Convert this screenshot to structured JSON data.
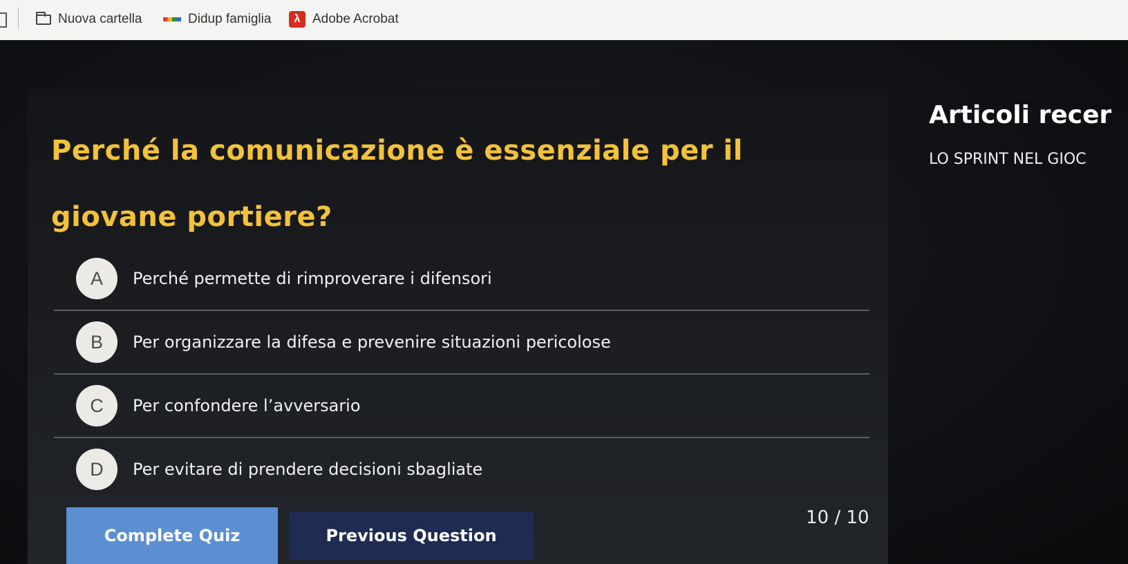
{
  "bookmarks_bar": {
    "items": [
      {
        "label": "Nuova cartella",
        "icon": "folder-icon"
      },
      {
        "label": "Didup famiglia",
        "icon": "didup-icon"
      },
      {
        "label": "Adobe Acrobat",
        "icon": "acrobat-icon"
      }
    ]
  },
  "quiz": {
    "question": "Perché la comunicazione è essenziale per il giovane portiere?",
    "options": [
      {
        "letter": "A",
        "text": "Perché permette di rimproverare i difensori"
      },
      {
        "letter": "B",
        "text": "Per organizzare la difesa e prevenire situazioni pericolose"
      },
      {
        "letter": "C",
        "text": "Per confondere l’avversario"
      },
      {
        "letter": "D",
        "text": "Per evitare di prendere decisioni sbagliate"
      }
    ],
    "complete_label": "Complete Quiz",
    "previous_label": "Previous Question",
    "counter": "10 / 10"
  },
  "sidebar": {
    "title": "Articoli recer",
    "article": "LO SPRINT NEL GIOC"
  },
  "colors": {
    "question": "#f3c23a",
    "complete_button": "#5b8fd2",
    "previous_button": "#1e2b52",
    "background": "#0a0b0e"
  }
}
